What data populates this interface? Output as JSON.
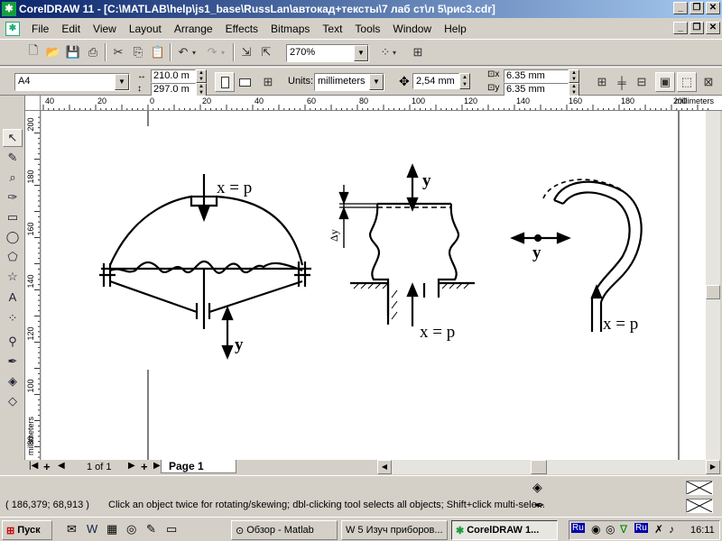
{
  "window": {
    "title": "CorelDRAW 11 - [C:\\MATLAB\\help\\js1_base\\RussLan\\автокад+тексты\\7 лаб ст\\л 5\\рис3.cdr]"
  },
  "menu": [
    "File",
    "Edit",
    "View",
    "Layout",
    "Arrange",
    "Effects",
    "Bitmaps",
    "Text",
    "Tools",
    "Window",
    "Help"
  ],
  "toolbar": {
    "zoom_value": "270%"
  },
  "property_bar": {
    "paper_size": "A4",
    "width": "210.0 m",
    "height": "297.0 m",
    "units_label": "Units:",
    "units_value": "millimeters",
    "nudge_value": "2,54 mm",
    "dup_x": "6.35 mm",
    "dup_y": "6.35 mm"
  },
  "ruler": {
    "top_labels": [
      "40",
      "20",
      "0",
      "20",
      "40",
      "60",
      "80",
      "100",
      "120",
      "140",
      "160",
      "180",
      "200"
    ],
    "top_unit": "millimeters",
    "left_labels": [
      "200",
      "180",
      "160",
      "140",
      "120",
      "100",
      "80"
    ],
    "left_unit": "millimeters"
  },
  "drawing": {
    "fig1_top_label": "x = p",
    "fig1_bottom_label": "y",
    "fig2_top_label": "y",
    "fig2_side_label": "Δy",
    "fig2_bottom_label": "x = p",
    "fig3_side_label": "y",
    "fig3_bottom_label": "x = p"
  },
  "page_nav": {
    "page_counter": "1 of 1",
    "page_tab": "Page 1"
  },
  "status": {
    "coordinates": "( 186,379; 68,913 )",
    "hint": "Click an object twice for rotating/skewing; dbl-clicking tool selects all objects; Shift+click multi-sele..."
  },
  "taskbar": {
    "start_label": "Пуск",
    "tasks": [
      "Обзор - Matlab",
      "5 Изуч приборов...",
      "CorelDRAW 1..."
    ],
    "clock": "16:11",
    "tray_lang": "Ru",
    "tray_lang2": "Ru"
  }
}
